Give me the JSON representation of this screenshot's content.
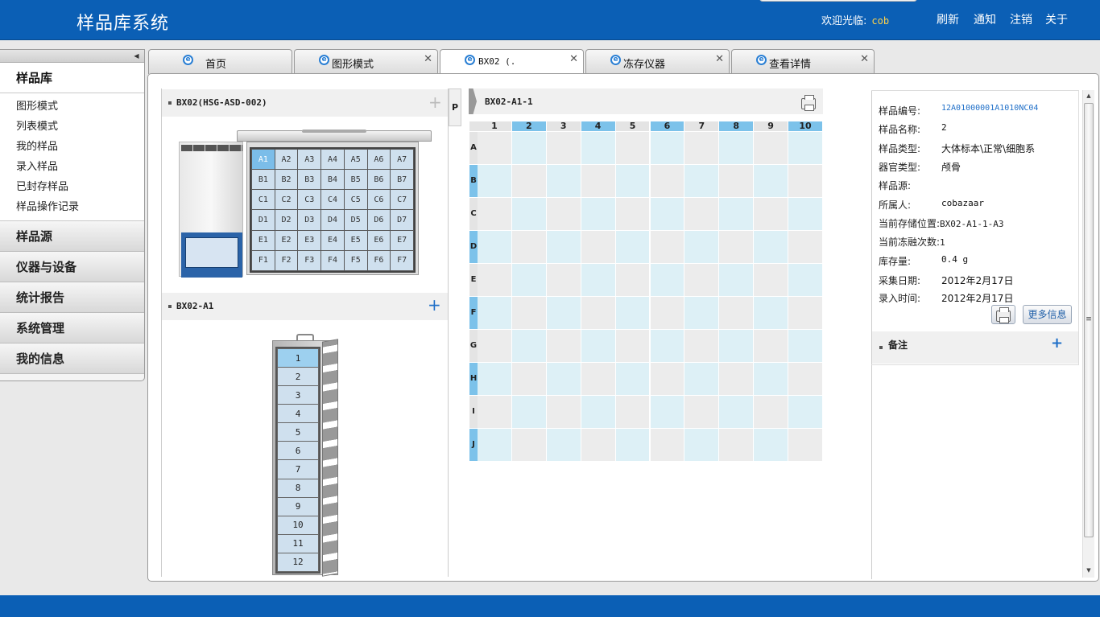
{
  "header": {
    "title": "样品库系统",
    "welcome_label": "欢迎光临:",
    "user": "cob",
    "links": [
      "刷新",
      "通知",
      "注销",
      "关于"
    ]
  },
  "sidebar": {
    "sections": [
      {
        "label": "样品库",
        "items": [
          "图形模式",
          "列表模式",
          "我的样品",
          "录入样品",
          "已封存样品",
          "样品操作记录"
        ]
      },
      {
        "label": "样品源"
      },
      {
        "label": "仪器与设备"
      },
      {
        "label": "统计报告"
      },
      {
        "label": "系统管理"
      },
      {
        "label": "我的信息"
      }
    ]
  },
  "tabs": [
    {
      "label": "首页"
    },
    {
      "label": "图形模式"
    },
    {
      "label": "BX02 (.",
      "active": true
    },
    {
      "label": "冻存仪器"
    },
    {
      "label": "查看详情"
    }
  ],
  "freezer_panel": {
    "title": "BX02(HSG-ASD-002)",
    "rows": [
      "A",
      "B",
      "C",
      "D",
      "E",
      "F"
    ],
    "cols": 7,
    "selected": "A1"
  },
  "rack_panel": {
    "title": "BX02-A1",
    "slots": [
      "1",
      "2",
      "3",
      "4",
      "5",
      "6",
      "7",
      "8",
      "9",
      "10",
      "11",
      "12"
    ],
    "selected": "1"
  },
  "pin_label": "P",
  "box_panel": {
    "title": "BX02-A1-1",
    "columns": [
      "1",
      "2",
      "3",
      "4",
      "5",
      "6",
      "7",
      "8",
      "9",
      "10"
    ],
    "rows": [
      "A",
      "B",
      "C",
      "D",
      "E",
      "F",
      "G",
      "H",
      "I",
      "J"
    ]
  },
  "detail": {
    "fields": [
      {
        "label": "样品编号:",
        "value": "12A01000001A1010NC04",
        "link": true
      },
      {
        "label": "样品名称:",
        "value": "2"
      },
      {
        "label": "样品类型:",
        "value": "大体标本\\正常\\细胞系"
      },
      {
        "label": "器官类型:",
        "value": "颅骨"
      },
      {
        "label": "样品源:",
        "value": ""
      },
      {
        "label": "所属人:",
        "value": "cobazaar"
      },
      {
        "label": "当前存储位置:",
        "value": "BX02-A1-1-A3",
        "inline": true
      },
      {
        "label": "当前冻融次数:",
        "value": "1",
        "inline": true
      },
      {
        "label": "库存量:",
        "value": "0.4 g"
      },
      {
        "label": "采集日期:",
        "value": "2012年2月17日"
      },
      {
        "label": "录入时间:",
        "value": "2012年2月17日"
      }
    ],
    "more_button": "更多信息",
    "notes_title": "备注"
  },
  "colors": {
    "brand_blue": "#0b5fb5",
    "cell_light": "#ddf0f6",
    "cell_gray": "#ececec",
    "header_blue": "#7cc2ea",
    "header_gray": "#e4e4e4",
    "link": "#1f6fc8"
  }
}
